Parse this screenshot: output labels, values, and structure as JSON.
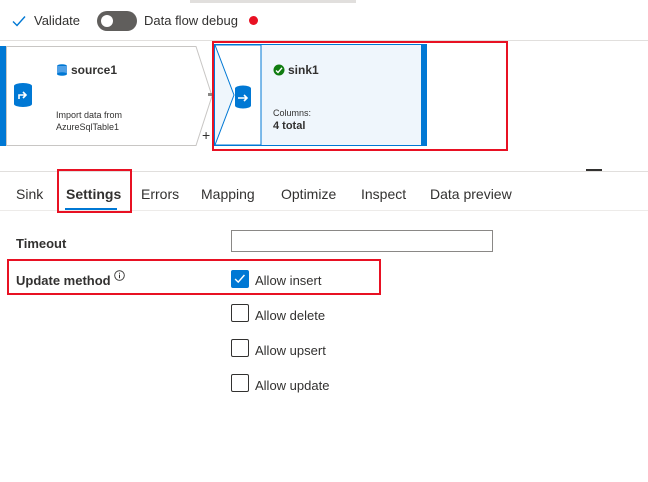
{
  "toolbar": {
    "validate_label": "Validate",
    "debug_label": "Data flow debug"
  },
  "canvas": {
    "source": {
      "title": "source1",
      "description": "Import data from AzureSqlTable1"
    },
    "add_symbol": "+",
    "sink": {
      "title": "sink1",
      "columns_label": "Columns:",
      "columns_value": "4 total"
    }
  },
  "tabs": [
    {
      "label": "Sink"
    },
    {
      "label": "Settings"
    },
    {
      "label": "Errors"
    },
    {
      "label": "Mapping"
    },
    {
      "label": "Optimize"
    },
    {
      "label": "Inspect"
    },
    {
      "label": "Data preview"
    }
  ],
  "active_tab": "Settings",
  "form": {
    "timeout_label": "Timeout",
    "timeout_value": "",
    "update_method_label": "Update method",
    "options": [
      {
        "label": "Allow insert",
        "checked": true
      },
      {
        "label": "Allow delete",
        "checked": false
      },
      {
        "label": "Allow upsert",
        "checked": false
      },
      {
        "label": "Allow update",
        "checked": false
      }
    ]
  },
  "colors": {
    "accent": "#0078d4",
    "highlight": "#e81123",
    "debug_status": "#e81123"
  }
}
